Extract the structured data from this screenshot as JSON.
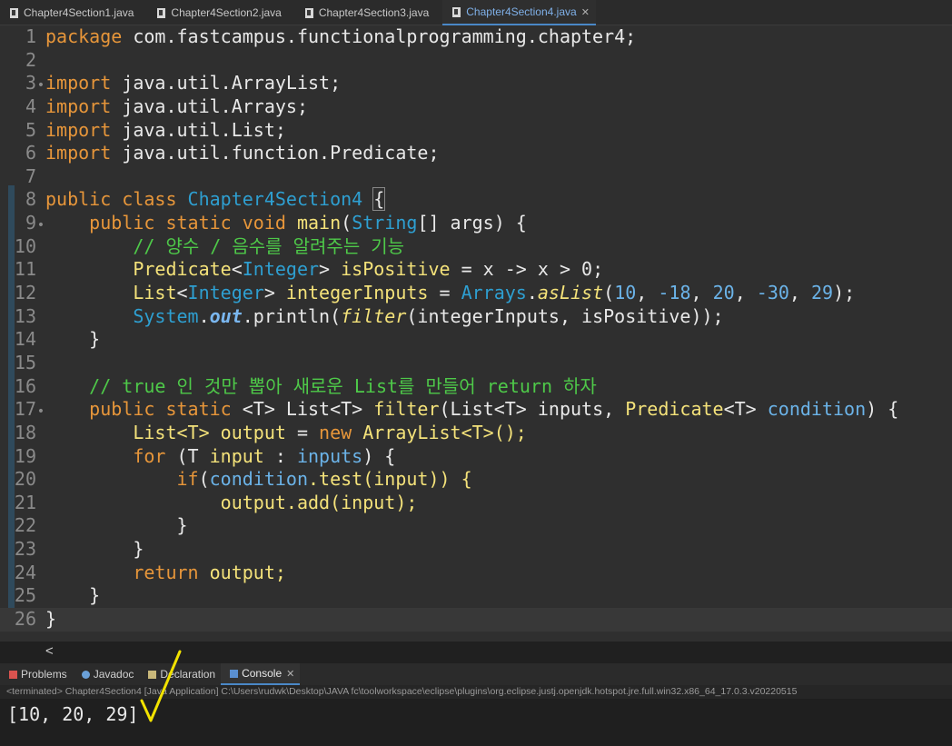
{
  "editor_tabs": [
    {
      "label": "Chapter4Section1.java",
      "active": false
    },
    {
      "label": "Chapter4Section2.java",
      "active": false
    },
    {
      "label": "Chapter4Section3.java",
      "active": false
    },
    {
      "label": "Chapter4Section4.java",
      "active": true
    }
  ],
  "code": {
    "line_numbers": [
      "1",
      "2",
      "3",
      "4",
      "5",
      "6",
      "7",
      "8",
      "9",
      "10",
      "11",
      "12",
      "13",
      "14",
      "15",
      "16",
      "17",
      "18",
      "19",
      "20",
      "21",
      "22",
      "23",
      "24",
      "25",
      "26"
    ],
    "package_kw": "package",
    "package_name": " com.fastcampus.functionalprogramming.chapter4;",
    "import_kw": "import",
    "imports": [
      " java.util.ArrayList;",
      " java.util.Arrays;",
      " java.util.List;",
      " java.util.function.Predicate;"
    ],
    "public_class": "public class",
    "class_name": "Chapter4Section4",
    "brace_open": "{",
    "main_mods": "public static void",
    "main_name": "main",
    "main_sig_a": "(",
    "string_type": "String",
    "main_sig_b": "[] args) {",
    "comment_1": "// 양수 / 음수를 알려주는 기능",
    "predicate_type": "Predicate",
    "integer_type": "Integer",
    "is_positive_var": " isPositive",
    "lambda_text": " = x -> x > 0;",
    "list_type": "List",
    "integer_inputs_var": " integerInputs",
    "assign_eq": " = ",
    "arrays_class": "Arrays",
    "aslist_method": "asList",
    "num_10": "10",
    "num_m18": "-18",
    "num_20": "20",
    "num_m30": "-30",
    "num_29": "29",
    "system_class": "System",
    "out_field": "out",
    "println_call": ".println(",
    "filter_call": "filter",
    "println_args": "(integerInputs, isPositive));",
    "brace_close": "}",
    "comment_2_a": "// true",
    "comment_2_b": " 인 것만 뽑아 새로운 ",
    "comment_2_c": "List",
    "comment_2_d": "를 만들어 ",
    "comment_2_e": "return",
    "comment_2_f": " 하자",
    "filter_mods": "public static",
    "filter_generic": " <T> List<T> ",
    "filter_name": "filter",
    "filter_params_a": "(List<T> inputs, ",
    "filter_predicate": "Predicate",
    "filter_params_b": "<T> ",
    "filter_condition": "condition",
    "filter_params_c": ") {",
    "output_decl_a": "List<T> ",
    "output_var": "output",
    "output_decl_b": " = ",
    "new_kw": "new",
    "output_decl_c": " ArrayList<T>();",
    "for_kw": "for",
    "for_a": " (T ",
    "for_input": "input",
    "for_b": " : ",
    "for_inputs": "inputs",
    "for_c": ") {",
    "if_kw": "if",
    "if_a": "(",
    "if_condition": "condition",
    "if_b": ".test(input)) {",
    "add_stmt": "output.add(input);",
    "return_kw": "return",
    "return_b": " output;"
  },
  "bottom_tabs": [
    {
      "label": "Problems",
      "active": false
    },
    {
      "label": "Javadoc",
      "active": false
    },
    {
      "label": "Declaration",
      "active": false
    },
    {
      "label": "Console",
      "active": true
    }
  ],
  "status_text": "<terminated> Chapter4Section4 [Java Application] C:\\Users\\rudwk\\Desktop\\JAVA fc\\toolworkspace\\eclipse\\plugins\\org.eclipse.justj.openjdk.hotspot.jre.full.win32.x86_64_17.0.3.v20220515",
  "console_output": "[10, 20, 29]",
  "colors": {
    "accent": "#4a88c7",
    "keyword": "#e7963a",
    "type": "#2e9fd1",
    "method": "#f4e27a",
    "comment": "#4ec949",
    "checkmark": "#f2e200"
  },
  "icons": {
    "tab_icon": "java-file-icon",
    "close": "close-icon",
    "scroll_left": "chevron-left-icon"
  }
}
